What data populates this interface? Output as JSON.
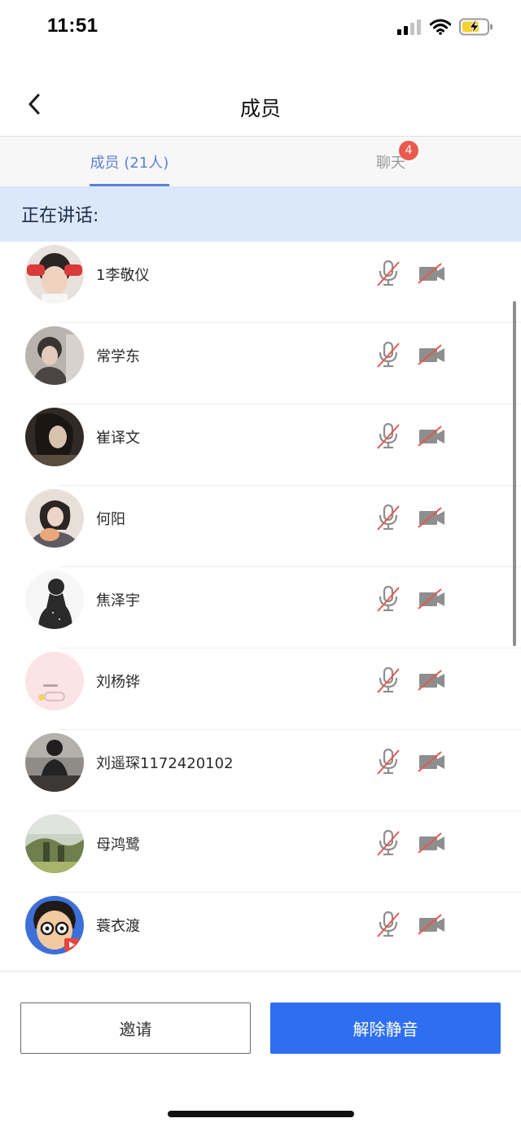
{
  "status_bar": {
    "time": "11:51"
  },
  "nav": {
    "title": "成员"
  },
  "tabs": {
    "members_label": "成员 (21人)",
    "chat_label": "聊天",
    "chat_badge": "4"
  },
  "speaking": {
    "label": "正在讲话:"
  },
  "members": [
    {
      "name": "1李敬仪",
      "mic": "muted",
      "camera": "off"
    },
    {
      "name": "常学东",
      "mic": "muted",
      "camera": "off"
    },
    {
      "name": "崔译文",
      "mic": "muted",
      "camera": "off"
    },
    {
      "name": "何阳",
      "mic": "muted",
      "camera": "off"
    },
    {
      "name": "焦泽宇",
      "mic": "muted",
      "camera": "off"
    },
    {
      "name": "刘杨铧",
      "mic": "muted",
      "camera": "off"
    },
    {
      "name": "刘遥琛1172420102",
      "mic": "muted",
      "camera": "off"
    },
    {
      "name": "母鸿鹭",
      "mic": "muted",
      "camera": "off"
    },
    {
      "name": "蓑衣渡",
      "mic": "muted",
      "camera": "off"
    }
  ],
  "bottom": {
    "invite_label": "邀请",
    "unmute_label": "解除静音"
  },
  "icons": {
    "back": "back-chevron-icon",
    "mic": "mic-muted-icon",
    "camera": "camera-off-icon",
    "signal": "cellular-signal-icon",
    "wifi": "wifi-icon",
    "battery": "battery-charging-icon"
  },
  "colors": {
    "accent": "#5b82d6",
    "primary_button": "#2d6ff0",
    "speaking_bg": "#dbe8fb",
    "badge": "#ea5a4e",
    "mute_slash": "#e05a4f",
    "battery_fill": "#f5d130"
  }
}
